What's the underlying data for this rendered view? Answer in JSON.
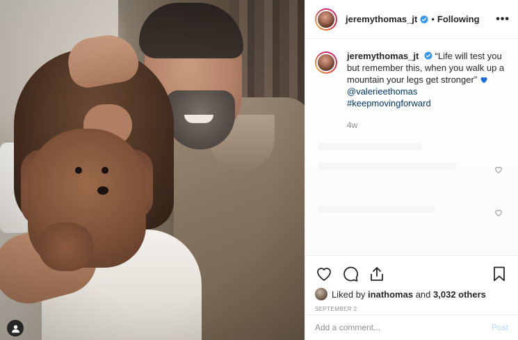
{
  "post": {
    "username": "jeremythomas_jt",
    "follow_state": "Following",
    "separator": "•",
    "more_label": "•••",
    "caption": {
      "text": "“Life will test you but remember this, when you walk up a mountain your legs get stronger”",
      "mention": "@valerieethomas",
      "hashtag": "#keepmovingforward"
    },
    "time_ago": "4w",
    "likes": {
      "prefix": "Liked by",
      "user": "inathomas",
      "joiner": "and",
      "count_text": "3,032 others"
    },
    "date": "SEPTEMBER 2"
  },
  "comment_box": {
    "placeholder": "Add a comment...",
    "post_label": "Post"
  },
  "icons": {
    "verified": "verified-badge-icon",
    "caption_heart": "blue-heart-icon",
    "like": "heart-icon",
    "comment": "comment-icon",
    "share": "share-icon",
    "save": "bookmark-icon",
    "tag": "user-tag-icon"
  },
  "colors": {
    "verified_blue": "#3897f0",
    "link_blue": "#00376b",
    "post_disabled": "#b3dbff",
    "secondary_text": "#8e8e8e"
  }
}
